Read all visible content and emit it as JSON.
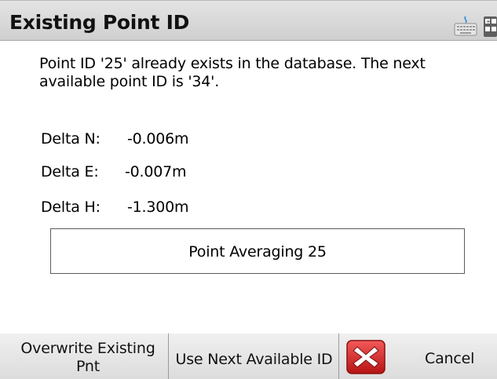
{
  "dialog": {
    "title": "Existing Point ID",
    "message": "Point ID '25' already exists in the database. The next available point ID is '34'.",
    "icons": [
      "keyboard-icon",
      "calculator-icon",
      "cancel-x-icon"
    ]
  },
  "deltas": [
    {
      "label": "Delta N:",
      "value": "-0.006m"
    },
    {
      "label": "Delta E:",
      "value": "-0.007m"
    },
    {
      "label": "Delta H:",
      "value": "-1.300m"
    }
  ],
  "point_averaging_button": "Point Averaging 25",
  "actions": {
    "overwrite_line1": "Overwrite Existing",
    "overwrite_line2": "Pnt",
    "use_next": "Use Next Available ID",
    "cancel": "Cancel"
  },
  "colors": {
    "cancel_icon_red": "#d62020",
    "title_bar": "#d8d8d8"
  }
}
